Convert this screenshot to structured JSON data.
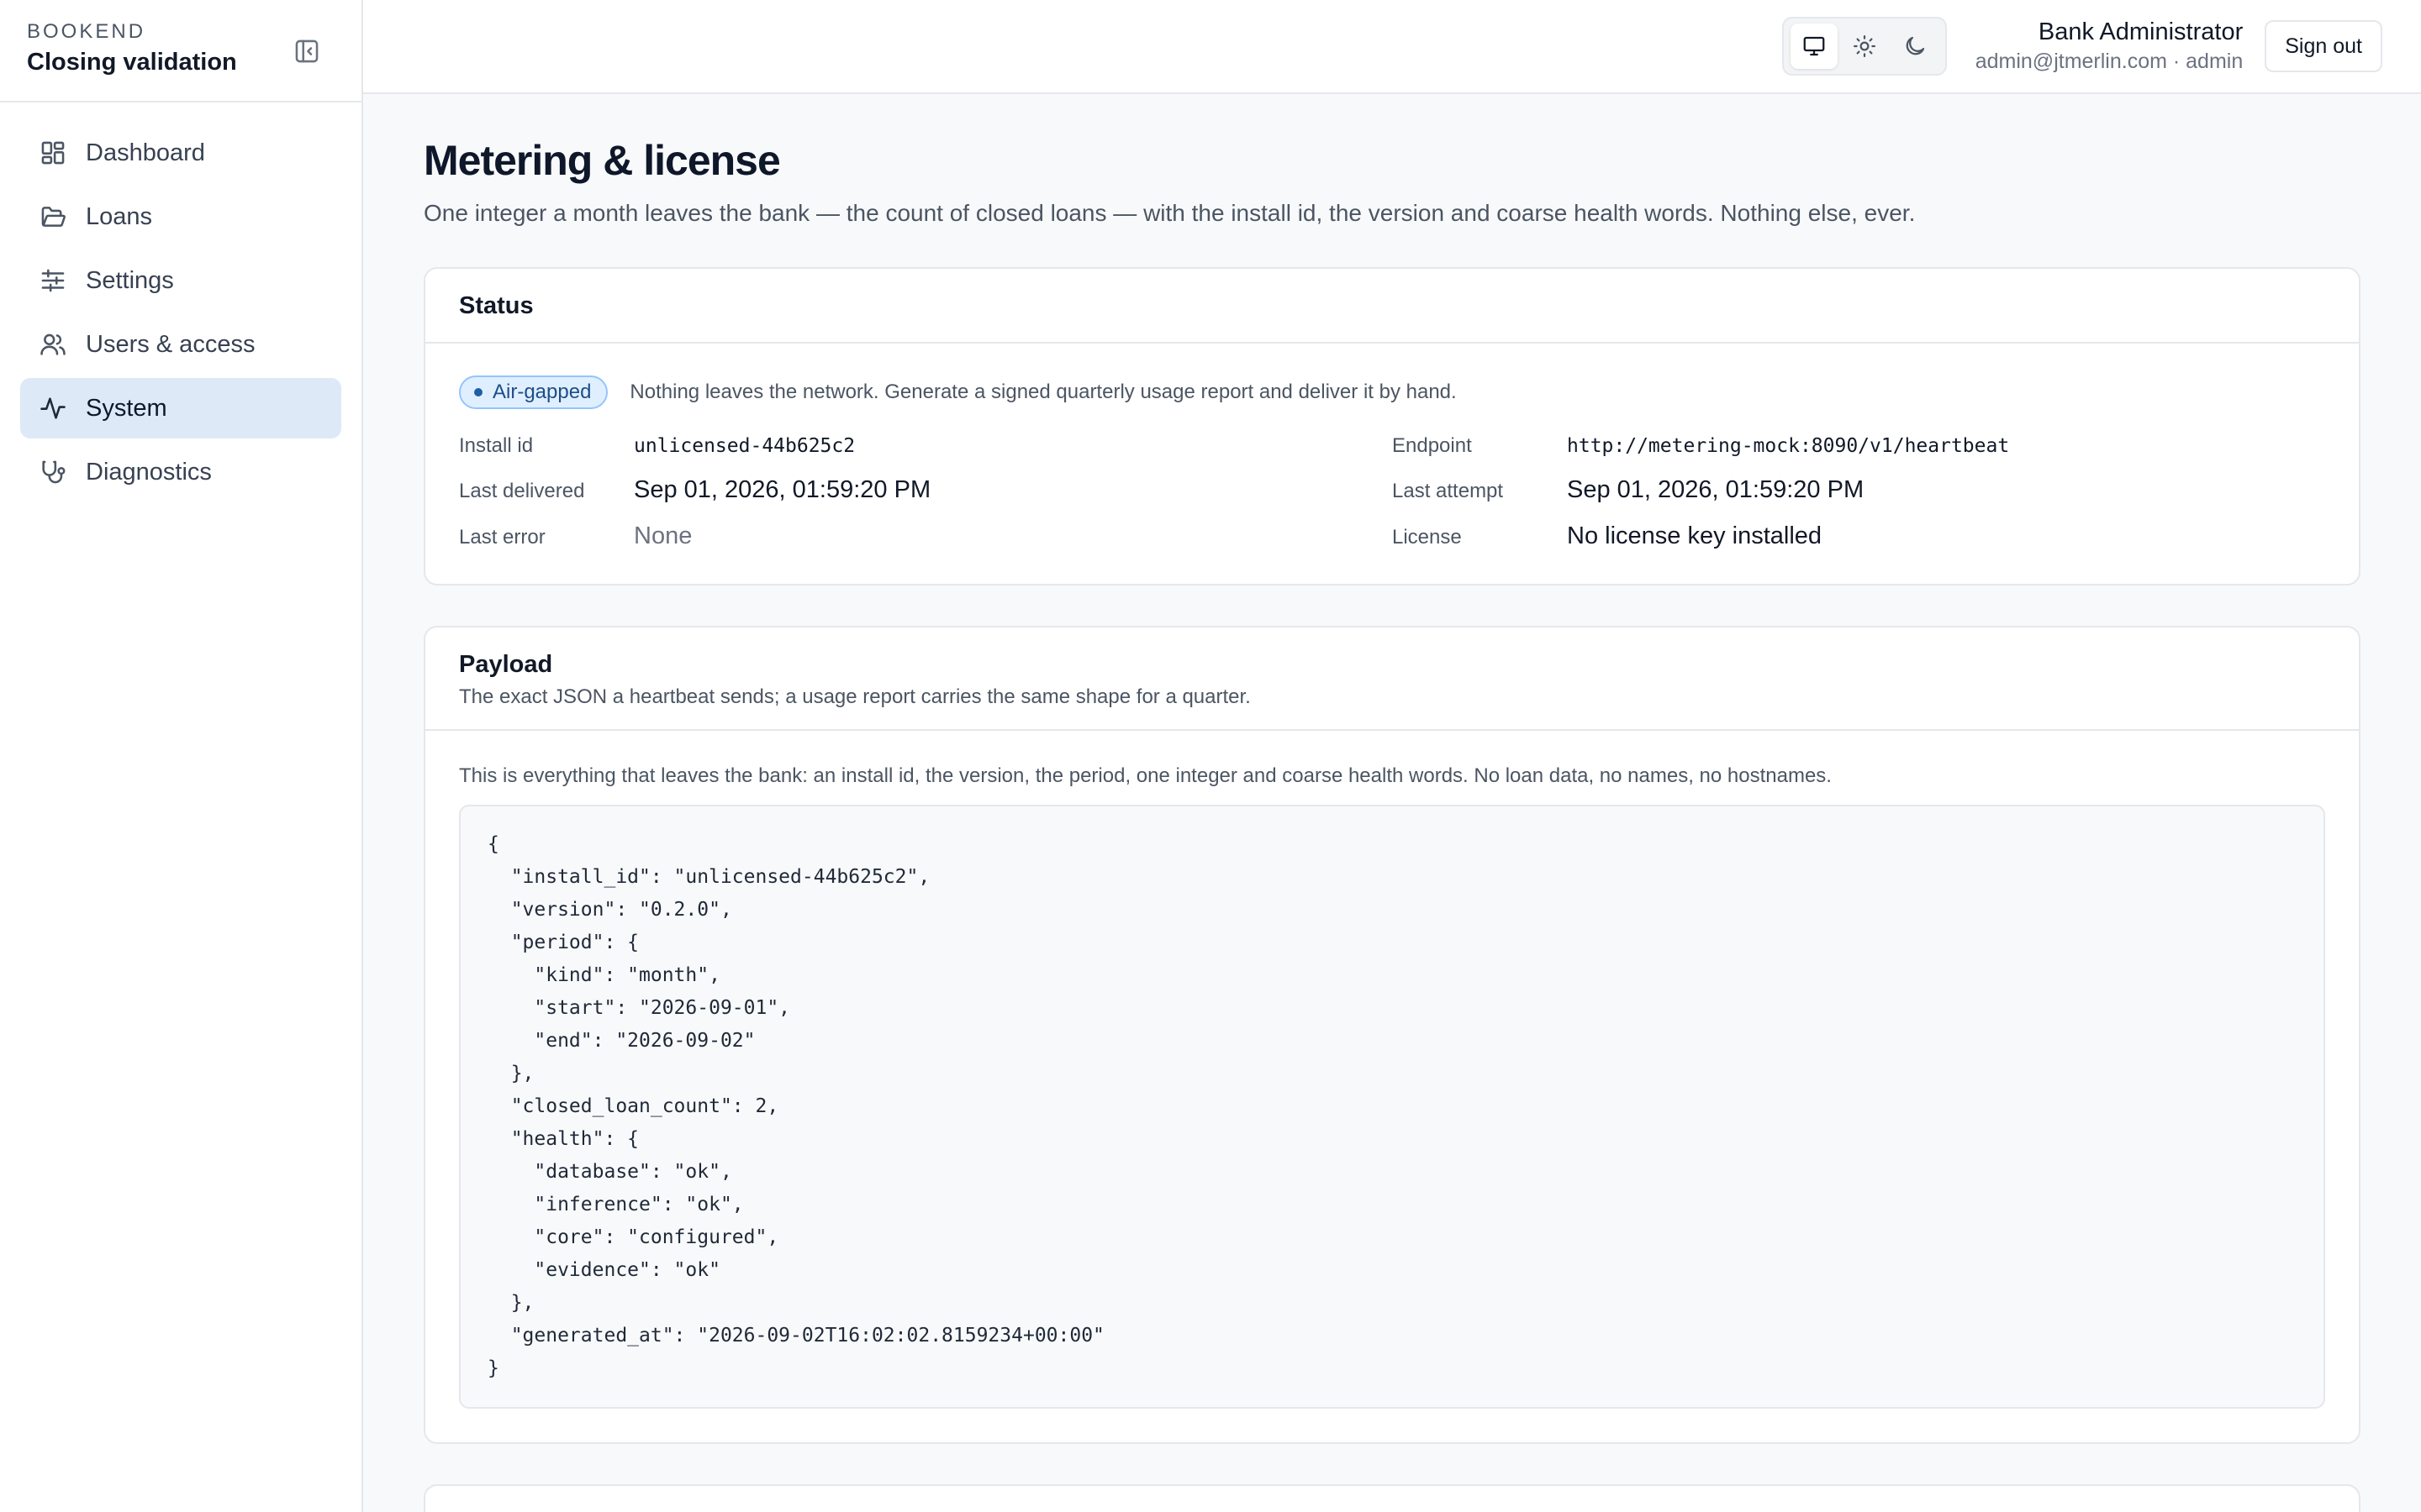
{
  "brand": {
    "eyebrow": "BOOKEND",
    "title": "Closing validation"
  },
  "sidebar": {
    "items": [
      {
        "label": "Dashboard",
        "icon": "dashboard-icon",
        "active": false
      },
      {
        "label": "Loans",
        "icon": "folder-icon",
        "active": false
      },
      {
        "label": "Settings",
        "icon": "sliders-icon",
        "active": false
      },
      {
        "label": "Users & access",
        "icon": "users-icon",
        "active": false
      },
      {
        "label": "System",
        "icon": "activity-icon",
        "active": true
      },
      {
        "label": "Diagnostics",
        "icon": "stethoscope-icon",
        "active": false
      }
    ]
  },
  "topbar": {
    "theme_options": [
      "monitor-icon",
      "sun-icon",
      "moon-icon"
    ],
    "user_name": "Bank Administrator",
    "user_meta": "admin@jtmerlin.com · admin",
    "signout_label": "Sign out"
  },
  "page": {
    "title": "Metering & license",
    "subtitle": "One integer a month leaves the bank — the count of closed loans — with the install id, the version and coarse health words. Nothing else, ever."
  },
  "status_card": {
    "title": "Status",
    "badge": "Air-gapped",
    "note": "Nothing leaves the network. Generate a signed quarterly usage report and deliver it by hand.",
    "left": [
      {
        "key": "Install id",
        "value": "unlicensed-44b625c2"
      },
      {
        "key": "Last delivered",
        "value": "Sep 01, 2026, 01:59:20 PM"
      },
      {
        "key": "Last error",
        "value": "None"
      }
    ],
    "right": [
      {
        "key": "Endpoint",
        "value": "http://metering-mock:8090/v1/heartbeat"
      },
      {
        "key": "Last attempt",
        "value": "Sep 01, 2026, 01:59:20 PM"
      },
      {
        "key": "License",
        "value": "No license key installed"
      }
    ]
  },
  "payload_card": {
    "title": "Payload",
    "description": "The exact JSON a heartbeat sends; a usage report carries the same shape for a quarter.",
    "note": "This is everything that leaves the bank: an install id, the version, the period, one integer and coarse health words. No loan data, no names, no hostnames.",
    "json_text": "{\n  \"install_id\": \"unlicensed-44b625c2\",\n  \"version\": \"0.2.0\",\n  \"period\": {\n    \"kind\": \"month\",\n    \"start\": \"2026-09-01\",\n    \"end\": \"2026-09-02\"\n  },\n  \"closed_loan_count\": 2,\n  \"health\": {\n    \"database\": \"ok\",\n    \"inference\": \"ok\",\n    \"core\": \"configured\",\n    \"evidence\": \"ok\"\n  },\n  \"generated_at\": \"2026-09-02T16:02:02.8159234+00:00\"\n}"
  },
  "colors": {
    "active_nav_bg": "#dde9f7",
    "badge_bg": "#e0efff",
    "badge_text": "#1d4e89",
    "page_bg": "#f8f9fa"
  }
}
